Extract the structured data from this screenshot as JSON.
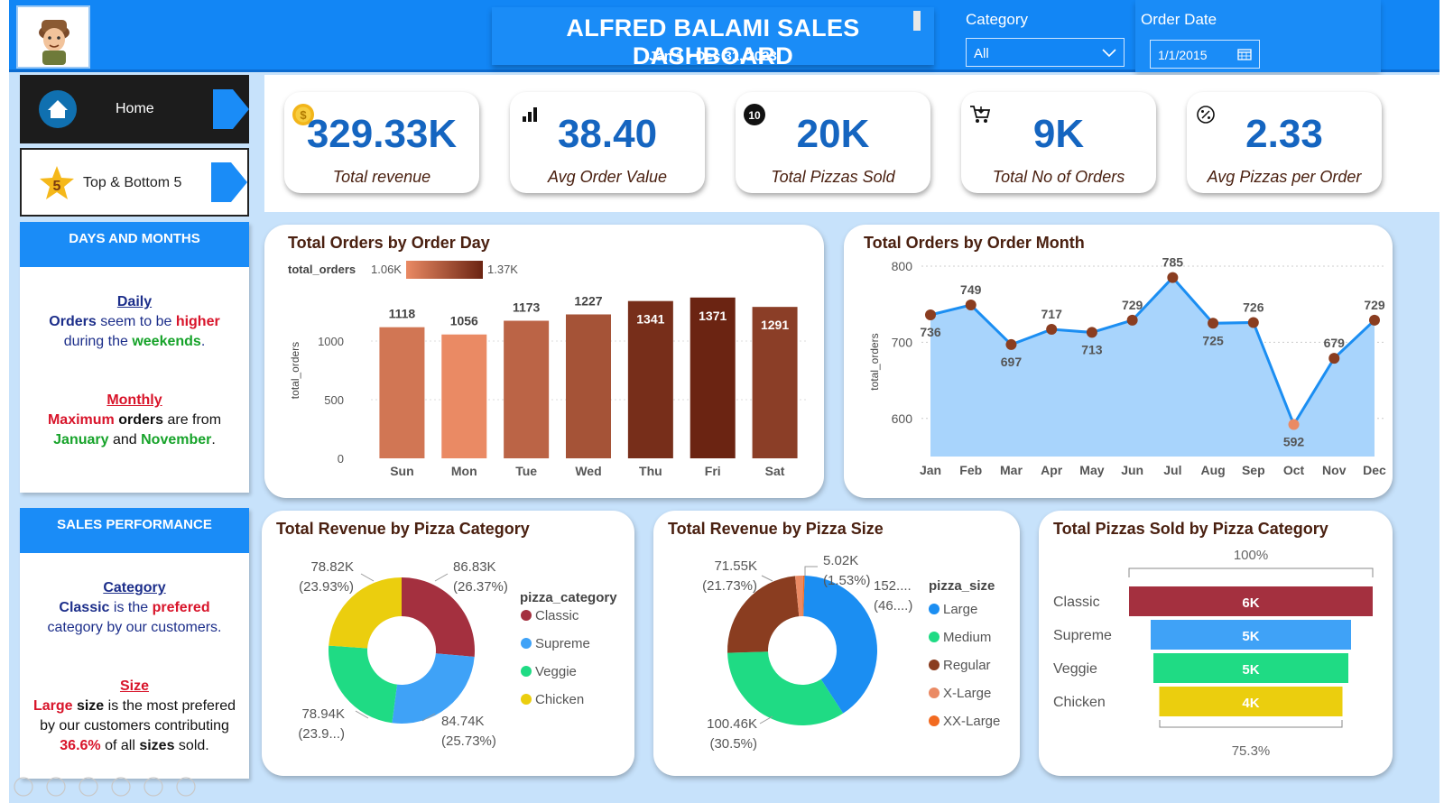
{
  "header": {
    "title": "ALFRED BALAMI SALES DASHBOARD",
    "subtitle": "Jan 1 - Dec 31, 2023",
    "category_label": "Category",
    "category_value": "All",
    "date_label": "Order Date",
    "date_value": "1/1/2015"
  },
  "nav": {
    "home": "Home",
    "top_bottom": "Top & Bottom 5",
    "top_badge": "5"
  },
  "days_months": {
    "heading": "DAYS AND MONTHS",
    "daily_head": "Daily",
    "daily_p1": "Orders",
    "daily_p2": " seem to be ",
    "daily_p3": "higher",
    "daily_p4": " during the ",
    "daily_p5": "weekends",
    "daily_p6": ".",
    "monthly_head": "Monthly",
    "monthly_p1": "Maximum",
    "monthly_p2": " orders",
    "monthly_p3": " are from ",
    "monthly_p4": "January",
    "monthly_p5": " and ",
    "monthly_p6": "November",
    "monthly_p7": "."
  },
  "sales_perf": {
    "heading": "SALES PERFORMANCE",
    "cat_head": "Category",
    "cat_p1": "Classic",
    "cat_p2": " is the ",
    "cat_p3": "prefered",
    "cat_p4": " category by our customers.",
    "size_head": "Size",
    "size_p1": "Large",
    "size_p2": "  size",
    "size_p3": " is the most prefered by our customers contributing ",
    "size_p4": "36.6%",
    "size_p5": " of all ",
    "size_p6": "sizes",
    "size_p7": " sold."
  },
  "kpis": [
    {
      "value": "329.33K",
      "label": "Total revenue",
      "icon": "coin-icon"
    },
    {
      "value": "38.40",
      "label": "Avg Order Value",
      "icon": "signal-bars-icon"
    },
    {
      "value": "20K",
      "label": "Total Pizzas Sold",
      "icon": "number-ten-icon",
      "badge": "10"
    },
    {
      "value": "9K",
      "label": "Total No of Orders",
      "icon": "cart-icon"
    },
    {
      "value": "2.33",
      "label": "Avg Pizzas per Order",
      "icon": "percent-badge-icon"
    }
  ],
  "colors": {
    "accent_blue": "#1a8cf7",
    "kpi_value": "#1565c0",
    "classic": "#a4303f",
    "supreme": "#3fa2f7",
    "veggie": "#1fdb84",
    "chicken": "#ebce0e",
    "large": "#1b8ef2",
    "medium": "#1fdb84",
    "regular": "#8a3d20",
    "xlarge": "#ea8a64",
    "xxlarge": "#f26a20"
  },
  "chart_data": [
    {
      "type": "bar",
      "title": "Total Orders by Order Day",
      "ylabel": "total_orders",
      "legend_title": "total_orders",
      "color_scale_min": "1.06K",
      "color_scale_max": "1.37K",
      "categories": [
        "Sun",
        "Mon",
        "Tue",
        "Wed",
        "Thu",
        "Fri",
        "Sat"
      ],
      "values": [
        1118,
        1056,
        1173,
        1227,
        1341,
        1371,
        1291
      ],
      "yticks": [
        0,
        500,
        1000
      ],
      "ylim": [
        0,
        1500
      ]
    },
    {
      "type": "area",
      "title": "Total Orders by Order Month",
      "ylabel": "total_orders",
      "categories": [
        "Jan",
        "Feb",
        "Mar",
        "Apr",
        "May",
        "Jun",
        "Jul",
        "Aug",
        "Sep",
        "Oct",
        "Nov",
        "Dec"
      ],
      "values": [
        736,
        749,
        697,
        717,
        713,
        729,
        785,
        725,
        726,
        592,
        679,
        729
      ],
      "yticks": [
        600,
        700,
        800
      ],
      "ylim": [
        550,
        800
      ]
    },
    {
      "type": "pie",
      "title": "Total Revenue by Pizza Category",
      "legend_title": "pizza_category",
      "slices": [
        {
          "name": "Classic",
          "value": 86.83,
          "label": "86.83K",
          "pct": "(26.37%)"
        },
        {
          "name": "Supreme",
          "value": 84.74,
          "label": "84.74K",
          "pct": "(25.73%)"
        },
        {
          "name": "Veggie",
          "value": 78.94,
          "label": "78.94K",
          "pct": "(23.9...)"
        },
        {
          "name": "Chicken",
          "value": 78.82,
          "label": "78.82K",
          "pct": "(23.93%)"
        }
      ]
    },
    {
      "type": "pie",
      "title": "Total Revenue by Pizza Size",
      "legend_title": "pizza_size",
      "slices": [
        {
          "name": "Large",
          "value": 120.5,
          "label": "152....",
          "pct": "(46....)"
        },
        {
          "name": "Medium",
          "value": 100.46,
          "label": "100.46K",
          "pct": "(30.5%)"
        },
        {
          "name": "Regular",
          "value": 71.55,
          "label": "71.55K",
          "pct": "(21.73%)"
        },
        {
          "name": "X-Large",
          "value": 5.02,
          "label": "5.02K",
          "pct": "(1.53%)"
        },
        {
          "name": "XX-Large",
          "value": 1.0,
          "label": "",
          "pct": ""
        }
      ]
    },
    {
      "type": "bar",
      "title": "Total Pizzas Sold by Pizza Category",
      "orientation": "funnel",
      "top_label": "100%",
      "bottom_label": "75.3%",
      "categories": [
        "Classic",
        "Supreme",
        "Veggie",
        "Chicken"
      ],
      "values": [
        6000,
        5000,
        5000,
        4000
      ],
      "labels": [
        "6K",
        "5K",
        "5K",
        "4K"
      ]
    }
  ]
}
